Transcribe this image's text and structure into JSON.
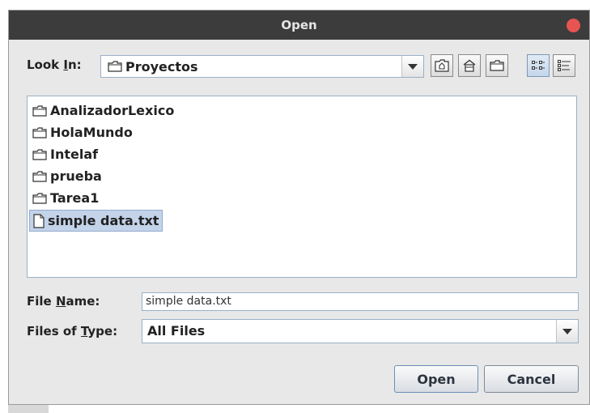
{
  "window": {
    "title": "Open"
  },
  "look_in": {
    "label_pre": "Look ",
    "label_mnemonic": "I",
    "label_post": "n:",
    "value": "Proyectos",
    "toolbar_icons": [
      "up-folder-icon",
      "home-icon",
      "new-folder-icon",
      "list-view-icon",
      "details-view-icon"
    ]
  },
  "files": [
    {
      "name": "AnalizadorLexico",
      "type": "folder"
    },
    {
      "name": "HolaMundo",
      "type": "folder"
    },
    {
      "name": "Intelaf",
      "type": "folder"
    },
    {
      "name": "prueba",
      "type": "folder"
    },
    {
      "name": "Tarea1",
      "type": "folder"
    },
    {
      "name": "simple data.txt",
      "type": "file",
      "selected": true
    }
  ],
  "file_name": {
    "label_pre": "File ",
    "label_mnemonic": "N",
    "label_post": "ame:",
    "value": "simple data.txt"
  },
  "file_type": {
    "label_pre": "Files of ",
    "label_mnemonic": "T",
    "label_post": "ype:",
    "value": "All Files"
  },
  "buttons": {
    "open": "Open",
    "cancel": "Cancel"
  },
  "colors": {
    "titlebar": "#3c3c3c",
    "close": "#e65552",
    "selection": "#c3d3e9",
    "dialog_bg": "#e8e8e8"
  }
}
